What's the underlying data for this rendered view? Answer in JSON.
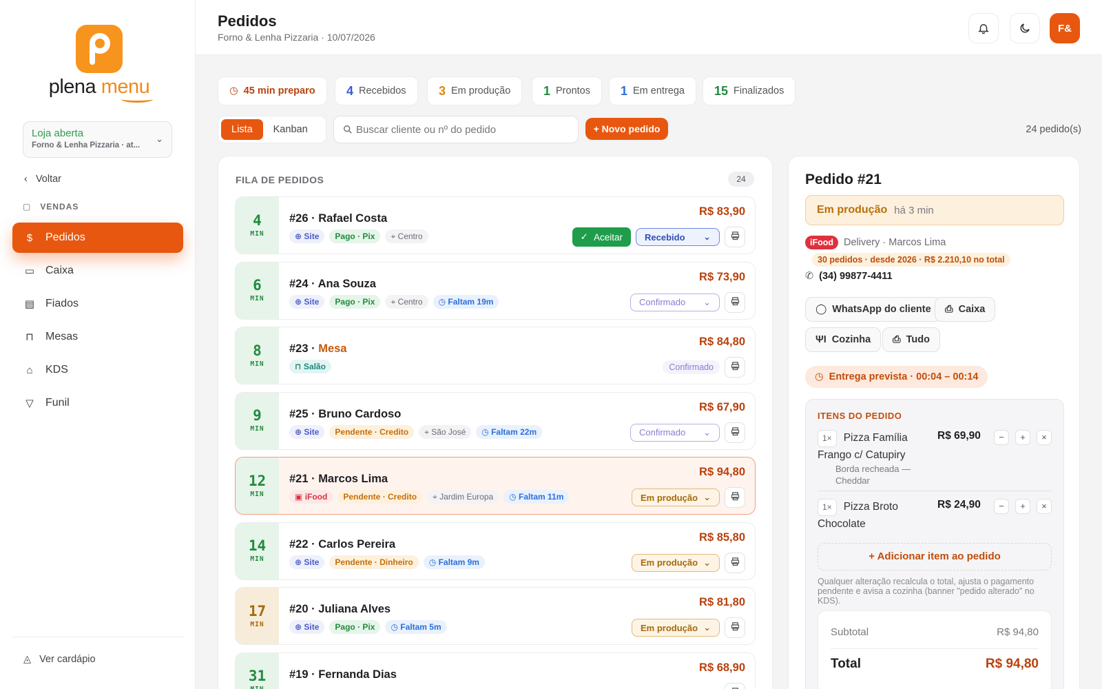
{
  "brand": {
    "name_a": "plena",
    "name_b": "menu"
  },
  "store": {
    "status": "Loja aberta",
    "name": "Forno & Lenha Pizzaria · at..."
  },
  "nav": {
    "back": "Voltar",
    "section": "VENDAS",
    "items": [
      {
        "label": "Pedidos"
      },
      {
        "label": "Caixa"
      },
      {
        "label": "Fiados"
      },
      {
        "label": "Mesas"
      },
      {
        "label": "KDS"
      },
      {
        "label": "Funil"
      }
    ],
    "footer": "Ver cardápio"
  },
  "header": {
    "title": "Pedidos",
    "subtitle": "Forno & Lenha Pizzaria · 10/07/2026",
    "avatar": "F&"
  },
  "stats": [
    {
      "value": "45 min preparo",
      "color": "#b8420d"
    },
    {
      "value": "4",
      "label": "Recebidos",
      "color": "#3d5bd0"
    },
    {
      "value": "3",
      "label": "Em produção",
      "color": "#d98a14"
    },
    {
      "value": "1",
      "label": "Prontos",
      "color": "#238a3f"
    },
    {
      "value": "1",
      "label": "Em entrega",
      "color": "#2d6fd8"
    },
    {
      "value": "15",
      "label": "Finalizados",
      "color": "#238a3f"
    }
  ],
  "view": {
    "list": "Lista",
    "kanban": "Kanban"
  },
  "search": {
    "placeholder": "Buscar cliente ou nº do pedido"
  },
  "new_order": "+ Novo pedido",
  "order_count": "24 pedido(s)",
  "queue": {
    "title": "FILA DE PEDIDOS",
    "count": "24",
    "orders": [
      {
        "min": "4",
        "unit": "MIN",
        "tone": "g",
        "title": "#26 · Rafael Costa",
        "price": "R$ 83,90",
        "chips": [
          {
            "t": "Site",
            "c": "c-site",
            "i": "⊕"
          },
          {
            "t": "Pago · Pix",
            "c": "c-pago"
          },
          {
            "t": "Centro",
            "c": "c-loc",
            "i": "⌖"
          }
        ],
        "accept": "Aceitar",
        "status": "Recebido",
        "skind": "s-rec"
      },
      {
        "min": "6",
        "unit": "MIN",
        "tone": "g",
        "title": "#24 · Ana Souza",
        "price": "R$ 73,90",
        "chips": [
          {
            "t": "Site",
            "c": "c-site",
            "i": "⊕"
          },
          {
            "t": "Pago · Pix",
            "c": "c-pago"
          },
          {
            "t": "Centro",
            "c": "c-loc",
            "i": "⌖"
          },
          {
            "t": "Faltam 19m",
            "c": "c-falt",
            "i": "◷"
          }
        ],
        "status": "Confirmado",
        "skind": "s-conf"
      },
      {
        "min": "8",
        "unit": "MIN",
        "tone": "g",
        "title": "#23 · ",
        "title_b": "Mesa",
        "price": "R$ 84,80",
        "chips": [
          {
            "t": "Salão",
            "c": "c-salao",
            "i": "⊓"
          }
        ],
        "status": "Confirmado",
        "skind": "s-plain"
      },
      {
        "min": "9",
        "unit": "MIN",
        "tone": "g",
        "title": "#25 · Bruno Cardoso",
        "price": "R$ 67,90",
        "chips": [
          {
            "t": "Site",
            "c": "c-site",
            "i": "⊕"
          },
          {
            "t": "Pendente · Credito",
            "c": "c-pend"
          },
          {
            "t": "São José",
            "c": "c-loc",
            "i": "⌖"
          },
          {
            "t": "Faltam 22m",
            "c": "c-falt",
            "i": "◷"
          }
        ],
        "status": "Confirmado",
        "skind": "s-conf"
      },
      {
        "min": "12",
        "unit": "MIN",
        "tone": "g",
        "sel": true,
        "title": "#21 · Marcos Lima",
        "price": "R$ 94,80",
        "chips": [
          {
            "t": "iFood",
            "c": "c-ifood",
            "i": "▣"
          },
          {
            "t": "Pendente · Credito",
            "c": "c-pend"
          },
          {
            "t": "Jardim Europa",
            "c": "c-loc",
            "i": "⌖"
          },
          {
            "t": "Faltam 11m",
            "c": "c-falt",
            "i": "◷"
          }
        ],
        "status": "Em produção",
        "skind": "s-prod"
      },
      {
        "min": "14",
        "unit": "MIN",
        "tone": "g",
        "title": "#22 · Carlos Pereira",
        "price": "R$ 85,80",
        "chips": [
          {
            "t": "Site",
            "c": "c-site",
            "i": "⊕"
          },
          {
            "t": "Pendente · Dinheiro",
            "c": "c-pend"
          },
          {
            "t": "Faltam 9m",
            "c": "c-falt",
            "i": "◷"
          }
        ],
        "status": "Em produção",
        "skind": "s-prod"
      },
      {
        "min": "17",
        "unit": "MIN",
        "tone": "y",
        "title": "#20 · Juliana Alves",
        "price": "R$ 81,80",
        "chips": [
          {
            "t": "Site",
            "c": "c-site",
            "i": "⊕"
          },
          {
            "t": "Pago · Pix",
            "c": "c-pago"
          },
          {
            "t": "Faltam 5m",
            "c": "c-falt",
            "i": "◷"
          }
        ],
        "status": "Em produção",
        "skind": "s-prod"
      },
      {
        "min": "31",
        "unit": "MIN",
        "tone": "g",
        "title": "#19 · Fernanda Dias",
        "price": "R$ 68,90",
        "chips": [],
        "status": "",
        "skind": "s-conf"
      }
    ]
  },
  "detail": {
    "title": "Pedido #21",
    "status": "Em produção",
    "since": "há 3 min",
    "source": "iFood",
    "delivery": "Delivery · Marcos Lima",
    "customer": "30 pedidos · desde 2026 · R$ 2.210,10 no total",
    "phone": "(34) 99877-4411",
    "buttons": {
      "whatsapp": "WhatsApp do cliente",
      "caixa": "Caixa",
      "cozinha": "Cozinha",
      "tudo": "Tudo"
    },
    "eta": "Entrega prevista · 00:04 – 00:14",
    "items_title": "ITENS DO PEDIDO",
    "items": [
      {
        "qty": "1×",
        "name": "Pizza Família Frango c/ Catupiry",
        "opt": "Borda recheada — Cheddar",
        "price": "R$ 69,90"
      },
      {
        "qty": "1×",
        "name": "Pizza Broto Chocolate",
        "opt": "",
        "price": "R$ 24,90"
      }
    ],
    "add_item": "+ Adicionar item ao pedido",
    "note": "Qualquer alteração recalcula o total, ajusta o pagamento pendente e avisa a cozinha (banner \"pedido alterado\" no KDS).",
    "subtotal_label": "Subtotal",
    "subtotal": "R$ 94,80",
    "total_label": "Total",
    "total": "R$ 94,80"
  }
}
